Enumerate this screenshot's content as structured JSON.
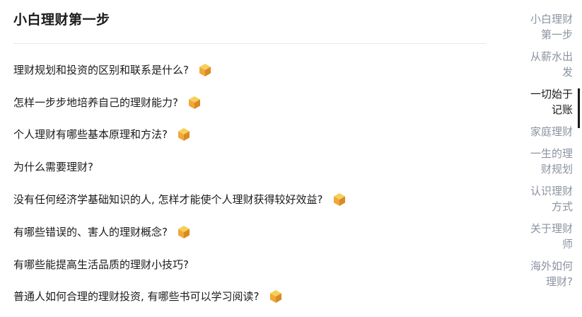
{
  "section": {
    "title": "小白理财第一步"
  },
  "questions": [
    {
      "text": "理财规划和投资的区别和联系是什么?",
      "badge": "gold-cube-icon"
    },
    {
      "text": "怎样一步步地培养自己的理财能力?",
      "badge": "gold-cube-icon"
    },
    {
      "text": "个人理财有哪些基本原理和方法?",
      "badge": "gold-cube-icon"
    },
    {
      "text": "为什么需要理财?",
      "badge": ""
    },
    {
      "text": "没有任何经济学基础知识的人, 怎样才能使个人理财获得较好效益?",
      "badge": "gold-cube-icon"
    },
    {
      "text": "有哪些错误的、害人的理财概念?",
      "badge": "gold-cube-icon"
    },
    {
      "text": "有哪些能提高生活品质的理财小技巧?",
      "badge": ""
    },
    {
      "text": "普通人如何合理的理财投资, 有哪些书可以学习阅读?",
      "badge": "gold-cube-icon"
    }
  ],
  "nav": {
    "items": [
      {
        "label": "小白理财\n第一步",
        "active": false
      },
      {
        "label": "从薪水出\n发",
        "active": false
      },
      {
        "label": "一切始于\n记账",
        "active": true
      },
      {
        "label": "家庭理财",
        "active": false
      },
      {
        "label": "一生的理\n财规划",
        "active": false
      },
      {
        "label": "认识理财\n方式",
        "active": false
      },
      {
        "label": "关于理财\n师",
        "active": false
      },
      {
        "label": "海外如何\n理财?",
        "active": false
      }
    ]
  },
  "colors": {
    "badge_top": "#f7cf5a",
    "badge_left": "#f0a83a",
    "badge_right": "#d98a22",
    "nav_inactive": "#8a93a0",
    "nav_active": "#1a1a1a"
  }
}
